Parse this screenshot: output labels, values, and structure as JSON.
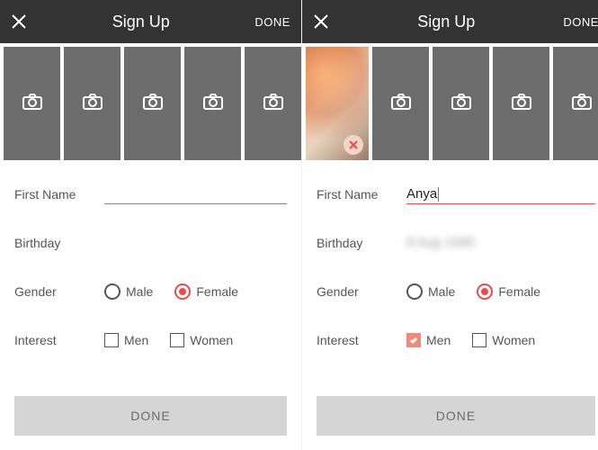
{
  "left": {
    "header": {
      "title": "Sign Up",
      "done": "DONE"
    },
    "form": {
      "first_name_label": "First Name",
      "first_name_value": "",
      "birthday_label": "Birthday",
      "birthday_value": "",
      "gender_label": "Gender",
      "gender_male": "Male",
      "gender_female": "Female",
      "gender_selected": "Female",
      "interest_label": "Interest",
      "interest_men": "Men",
      "interest_women": "Women",
      "interest_men_checked": false,
      "interest_women_checked": false
    },
    "bottom_button": "DONE"
  },
  "right": {
    "header": {
      "title": "Sign Up",
      "done": "DONE"
    },
    "form": {
      "first_name_label": "First Name",
      "first_name_value": "Anya",
      "birthday_label": "Birthday",
      "birthday_value": "(hidden)",
      "gender_label": "Gender",
      "gender_male": "Male",
      "gender_female": "Female",
      "gender_selected": "Female",
      "interest_label": "Interest",
      "interest_men": "Men",
      "interest_women": "Women",
      "interest_men_checked": true,
      "interest_women_checked": false
    },
    "bottom_button": "DONE"
  },
  "colors": {
    "accent": "#e94b4b",
    "header_bg": "#333333",
    "slot_bg": "#6c6c6c",
    "btn_bg": "#d5d5d5"
  }
}
